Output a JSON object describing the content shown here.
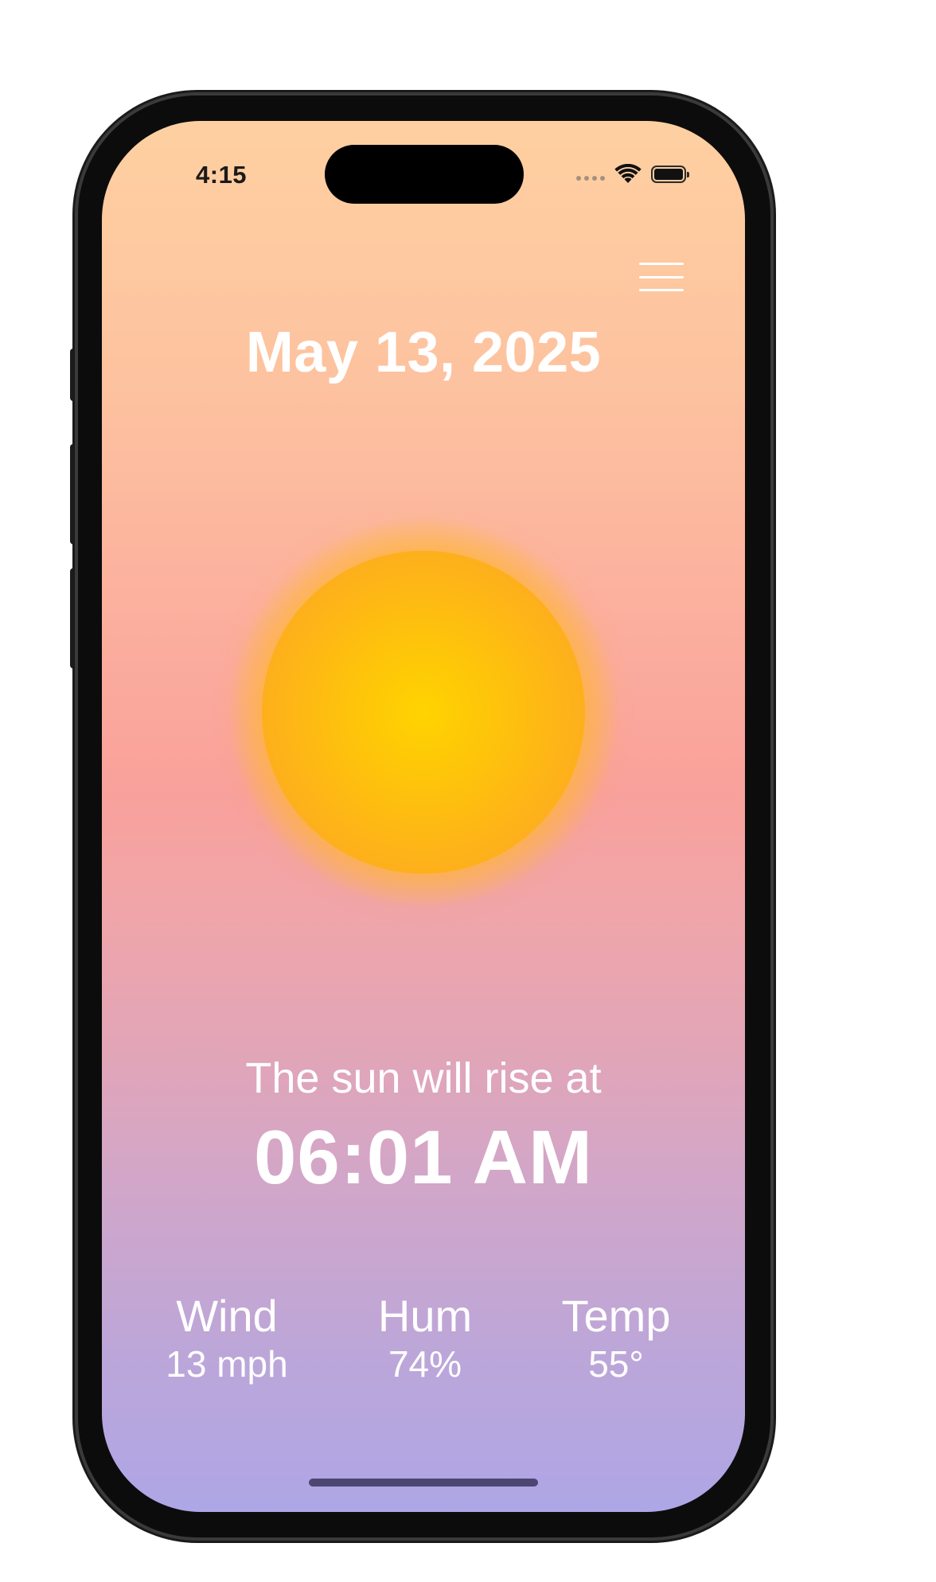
{
  "status_bar": {
    "time": "4:15"
  },
  "header": {
    "date": "May 13, 2025",
    "menu_icon": "hamburger-menu-icon"
  },
  "sun": {
    "caption": "The sun will rise at",
    "time": "06:01 AM"
  },
  "stats": {
    "wind": {
      "label": "Wind",
      "value": "13 mph"
    },
    "humidity": {
      "label": "Hum",
      "value": "74%"
    },
    "temperature": {
      "label": "Temp",
      "value": "55°"
    }
  },
  "colors": {
    "gradient_top": "#fed0a1",
    "gradient_middle": "#f9a19b",
    "gradient_bottom": "#aea6e6",
    "sun_center": "#ffd300",
    "sun_edge": "#f9a323"
  }
}
